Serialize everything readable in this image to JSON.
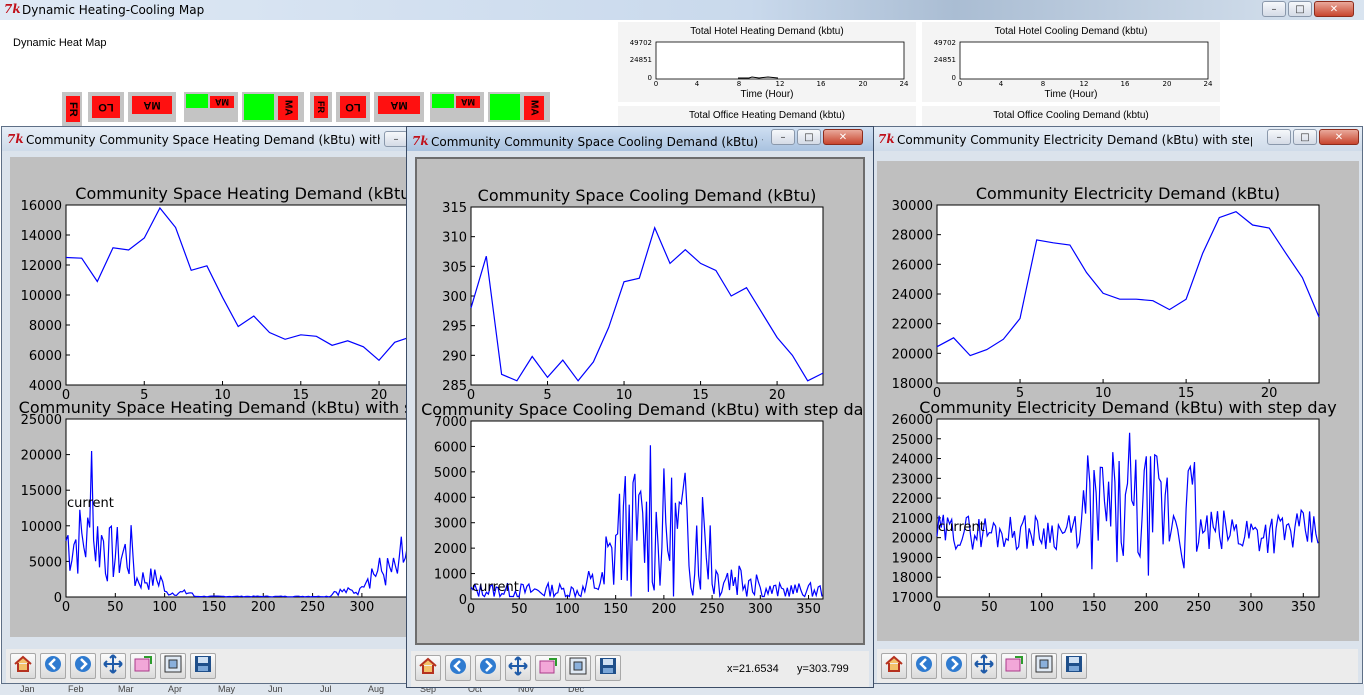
{
  "main_window": {
    "title": "Dynamic Heating-Cooling Map",
    "app_icon": "tk-feather-icon",
    "heatmap_label": "Dynamic Heat Map",
    "tile_labels": [
      "FR",
      "LO",
      "MA",
      "MA",
      "MA",
      "FR",
      "LO",
      "MA",
      "MA",
      "MA"
    ],
    "mini_charts": [
      {
        "title": "Total Hotel Heating Demand (kbtu)",
        "xlabel": "Time (Hour)",
        "yticks": [
          "49702",
          "24851",
          "0"
        ],
        "xticks": [
          "0",
          "4",
          "8",
          "12",
          "16",
          "20",
          "24"
        ]
      },
      {
        "title": "Total Hotel Cooling Demand (kbtu)",
        "xlabel": "Time (Hour)",
        "yticks": [
          "49702",
          "24851",
          "0"
        ],
        "xticks": [
          "0",
          "4",
          "8",
          "12",
          "16",
          "20",
          "24"
        ]
      },
      {
        "title": "Total Office Heating Demand (kbtu)"
      },
      {
        "title": "Total Office Cooling Demand (kbtu)"
      }
    ],
    "months": [
      "Jan",
      "Feb",
      "Mar",
      "Apr",
      "May",
      "Jun",
      "Jul",
      "Aug",
      "Sep",
      "Oct",
      "Nov",
      "Dec"
    ]
  },
  "windows": {
    "heating": {
      "title": "Community Community Space Heating Demand (kBtu) with step..."
    },
    "cooling": {
      "title": "Community Community Space Cooling Demand (kBtu) with ...",
      "coord_x": "x=21.6534",
      "coord_y": "y=303.799"
    },
    "electricity": {
      "title": "Community Community Electricity Demand (kBtu) with step day"
    }
  },
  "toolbar": {
    "buttons": [
      "home-icon",
      "back-arrow-icon",
      "forward-arrow-icon",
      "pan-icon",
      "zoom-icon",
      "subplots-icon",
      "save-icon"
    ]
  },
  "window_controls": {
    "minimize": "–",
    "maximize": "□",
    "close": "✕"
  },
  "colors": {
    "line": "#0000ff",
    "figure_bg": "#bfbfbf",
    "tile_red": "#ff1010",
    "tile_green": "#00ff00"
  },
  "chart_data": [
    {
      "id": "heat-top",
      "type": "line",
      "title": "Community Space Heating Demand (kBtu)",
      "x": [
        0,
        1,
        2,
        3,
        4,
        5,
        6,
        7,
        8,
        9,
        10,
        11,
        12,
        13,
        14,
        15,
        16,
        17,
        18,
        19,
        20,
        21,
        22,
        23
      ],
      "y": [
        12500,
        12450,
        10900,
        13150,
        13000,
        13800,
        15800,
        14500,
        11650,
        11950,
        9850,
        7900,
        8600,
        7500,
        7050,
        7350,
        7250,
        6650,
        6950,
        6550,
        5650,
        6850,
        7200,
        7500
      ],
      "xlim": [
        0,
        23
      ],
      "ylim": [
        4000,
        16000
      ],
      "xticks": [
        0,
        5,
        10,
        15,
        20
      ],
      "yticks": [
        4000,
        6000,
        8000,
        10000,
        12000,
        14000,
        16000
      ]
    },
    {
      "id": "heat-bottom",
      "type": "line",
      "title": "Community Space Heating Demand (kBtu) with step day",
      "annotation": "current",
      "xlim": [
        0,
        365
      ],
      "ylim": [
        0,
        25000
      ],
      "xticks": [
        0,
        50,
        100,
        150,
        200,
        250,
        300
      ],
      "yticks": [
        0,
        5000,
        10000,
        15000,
        20000,
        25000
      ]
    },
    {
      "id": "cool-top",
      "type": "line",
      "title": "Community Space Cooling Demand (kBtu)",
      "x": [
        0,
        1,
        2,
        3,
        4,
        5,
        6,
        7,
        8,
        9,
        10,
        11,
        12,
        13,
        14,
        15,
        16,
        17,
        18,
        19,
        20,
        21,
        22,
        23
      ],
      "y": [
        298,
        306.7,
        286.8,
        285.7,
        289.8,
        286.3,
        289.2,
        285.7,
        288.9,
        294.7,
        302.4,
        303,
        311.5,
        305.5,
        307.8,
        305.5,
        304.3,
        300,
        301.4,
        297.2,
        293,
        290,
        285.7,
        287
      ],
      "xlim": [
        0,
        23
      ],
      "ylim": [
        285,
        315
      ],
      "xticks": [
        0,
        5,
        10,
        15,
        20
      ],
      "yticks": [
        285,
        290,
        295,
        300,
        305,
        310,
        315
      ]
    },
    {
      "id": "cool-bottom",
      "type": "line",
      "title": "Community Space Cooling Demand (kBtu) with step day",
      "annotation": "current",
      "xlim": [
        0,
        365
      ],
      "ylim": [
        0,
        7000
      ],
      "xticks": [
        0,
        50,
        100,
        150,
        200,
        250,
        300,
        350
      ],
      "yticks": [
        0,
        1000,
        2000,
        3000,
        4000,
        5000,
        6000,
        7000
      ]
    },
    {
      "id": "elec-top",
      "type": "line",
      "title": "Community Electricity Demand (kBtu)",
      "x": [
        0,
        1,
        2,
        3,
        4,
        5,
        6,
        7,
        8,
        9,
        10,
        11,
        12,
        13,
        14,
        15,
        16,
        17,
        18,
        19,
        20,
        21,
        22,
        23
      ],
      "y": [
        20450,
        21050,
        19850,
        20250,
        20950,
        22350,
        27650,
        27450,
        27300,
        25450,
        24050,
        23650,
        23650,
        23550,
        22950,
        23650,
        26750,
        29150,
        29550,
        28650,
        28450,
        26750,
        25100,
        22450
      ],
      "xlim": [
        0,
        23
      ],
      "ylim": [
        18000,
        30000
      ],
      "xticks": [
        0,
        5,
        10,
        15,
        20
      ],
      "yticks": [
        18000,
        20000,
        22000,
        24000,
        26000,
        28000,
        30000
      ]
    },
    {
      "id": "elec-bottom",
      "type": "line",
      "title": "Community Electricity Demand (kBtu) with step day",
      "annotation": "current",
      "xlim": [
        0,
        365
      ],
      "ylim": [
        17000,
        26000
      ],
      "xticks": [
        0,
        50,
        100,
        150,
        200,
        250,
        300,
        350
      ],
      "yticks": [
        17000,
        18000,
        19000,
        20000,
        21000,
        22000,
        23000,
        24000,
        25000,
        26000
      ]
    }
  ]
}
